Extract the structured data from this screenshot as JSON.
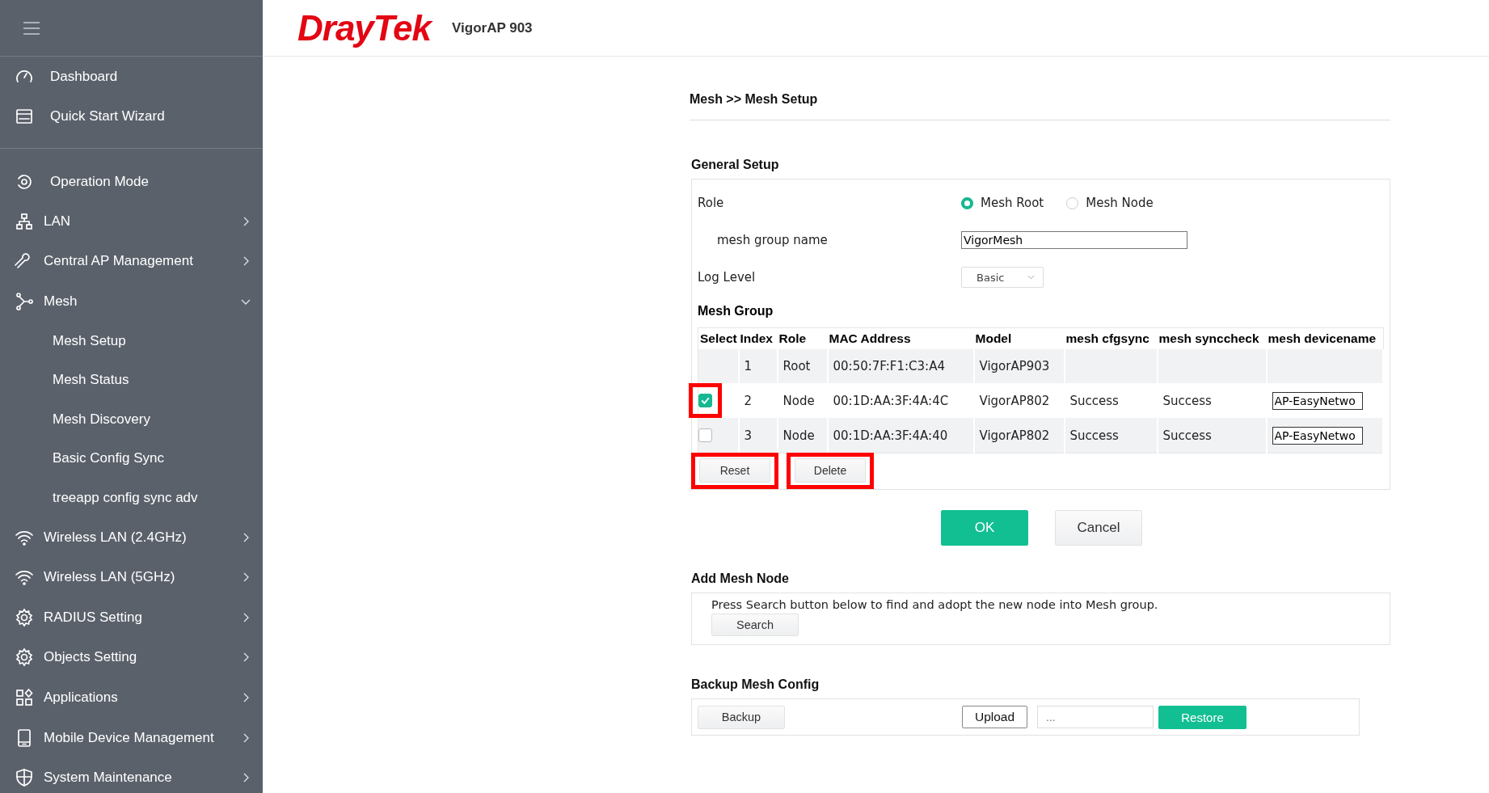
{
  "sidebar": {
    "items": [
      {
        "label": "Dashboard"
      },
      {
        "label": "Quick Start Wizard"
      },
      {
        "label": "Operation Mode"
      },
      {
        "label": "LAN",
        "expanded": false
      },
      {
        "label": "Central AP Management",
        "expanded": false
      },
      {
        "label": "Mesh",
        "expanded": true,
        "children": [
          {
            "label": "Mesh Setup"
          },
          {
            "label": "Mesh Status"
          },
          {
            "label": "Mesh Discovery"
          },
          {
            "label": "Basic Config Sync"
          },
          {
            "label": "treeapp config sync adv"
          }
        ]
      },
      {
        "label": "Wireless LAN (2.4GHz)",
        "expanded": false
      },
      {
        "label": "Wireless LAN (5GHz)",
        "expanded": false
      },
      {
        "label": "RADIUS Setting",
        "expanded": false
      },
      {
        "label": "Objects Setting",
        "expanded": false
      },
      {
        "label": "Applications",
        "expanded": false
      },
      {
        "label": "Mobile Device Management",
        "expanded": false
      },
      {
        "label": "System Maintenance",
        "expanded": false
      }
    ]
  },
  "header": {
    "logo": "DrayTek",
    "model": "VigorAP 903"
  },
  "breadcrumb": "Mesh >> Mesh Setup",
  "general_setup": {
    "title": "General Setup",
    "role": {
      "label": "Role",
      "options": [
        {
          "label": "Mesh Root",
          "selected": true
        },
        {
          "label": "Mesh Node",
          "selected": false
        }
      ]
    },
    "group_name": {
      "label": "mesh group name",
      "value": "VigorMesh"
    },
    "log_level": {
      "label": "Log Level",
      "value": "Basic"
    },
    "mesh_group": {
      "title": "Mesh Group",
      "columns": [
        "Select",
        "Index",
        "Role",
        "MAC Address",
        "Model",
        "mesh cfgsync",
        "mesh synccheck",
        "mesh devicename"
      ],
      "rows": [
        {
          "index": "1",
          "role": "Root",
          "mac": "00:50:7F:F1:C3:A4",
          "model": "VigorAP903"
        },
        {
          "checked": true,
          "highlighted": true,
          "index": "2",
          "role": "Node",
          "mac": "00:1D:AA:3F:4A:4C",
          "model": "VigorAP802",
          "cfgsync": "Success",
          "synccheck": "Success",
          "devicename": "AP-EasyNetwo"
        },
        {
          "checked": false,
          "highlighted": false,
          "index": "3",
          "role": "Node",
          "mac": "00:1D:AA:3F:4A:40",
          "model": "VigorAP802",
          "cfgsync": "Success",
          "synccheck": "Success",
          "devicename": "AP-EasyNetwo"
        }
      ],
      "buttons": [
        {
          "label": "Reset",
          "highlighted": true
        },
        {
          "label": "Delete",
          "highlighted": true
        }
      ]
    }
  },
  "actions": {
    "ok": "OK",
    "cancel": "Cancel"
  },
  "add_mesh_node": {
    "title": "Add Mesh Node",
    "text": "Press Search button below to find and adopt the new node into Mesh group.",
    "button": "Search"
  },
  "backup": {
    "title": "Backup Mesh Config",
    "backup": "Backup",
    "upload": "Upload",
    "file_placeholder": "...",
    "restore": "Restore"
  }
}
